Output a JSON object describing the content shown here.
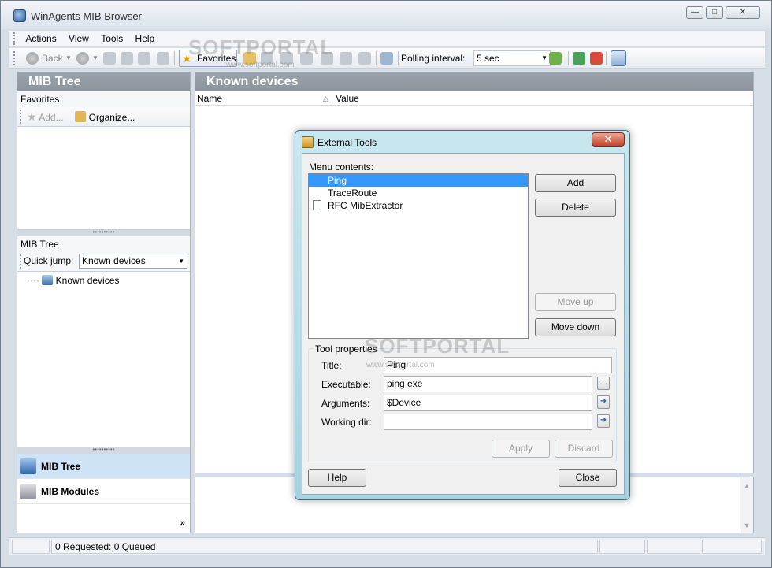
{
  "window": {
    "title": "WinAgents MIB Browser"
  },
  "menubar": {
    "items": [
      "Actions",
      "View",
      "Tools",
      "Help"
    ]
  },
  "toolbar": {
    "back_label": "Back",
    "favorites_label": "Favorites",
    "polling_label": "Polling interval:",
    "polling_value": "5 sec"
  },
  "left_panel": {
    "header": "MIB Tree",
    "favorites_label": "Favorites",
    "add_label": "Add...",
    "organize_label": "Organize...",
    "mib_tree_label": "MIB Tree",
    "quick_jump_label": "Quick jump:",
    "quick_jump_value": "Known devices",
    "tree_root": "Known devices",
    "nav": [
      {
        "label": "MIB Tree"
      },
      {
        "label": "MIB Modules"
      }
    ]
  },
  "right_panel": {
    "header": "Known devices",
    "columns": [
      "Name",
      "Value"
    ]
  },
  "status": {
    "text": "0 Requested: 0 Queued"
  },
  "dialog": {
    "title": "External Tools",
    "menu_contents_label": "Menu contents:",
    "items": [
      {
        "label": "Ping",
        "selected": true
      },
      {
        "label": "TraceRoute",
        "selected": false
      },
      {
        "label": "RFC MibExtractor",
        "selected": false
      }
    ],
    "buttons": {
      "add": "Add",
      "delete": "Delete",
      "move_up": "Move up",
      "move_down": "Move down",
      "apply": "Apply",
      "discard": "Discard",
      "help": "Help",
      "close": "Close"
    },
    "properties": {
      "group_label": "Tool properties",
      "title_label": "Title:",
      "title_value": "Ping",
      "executable_label": "Executable:",
      "executable_value": "ping.exe",
      "arguments_label": "Arguments:",
      "arguments_value": "$Device",
      "working_dir_label": "Working dir:",
      "working_dir_value": ""
    }
  },
  "watermark": {
    "brand": "SOFTPORTAL",
    "url": "www.softportal.com"
  }
}
